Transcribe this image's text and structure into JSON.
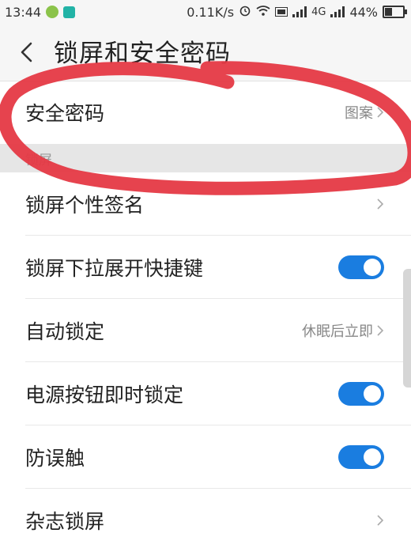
{
  "status_bar": {
    "time": "13:44",
    "net_speed": "0.11K/s",
    "network_type": "4G",
    "battery_percent": "44%"
  },
  "header": {
    "back_icon": "chevron-left-icon",
    "title": "锁屏和安全密码"
  },
  "rows": {
    "security_password": {
      "label": "安全密码",
      "value": "图案"
    },
    "section_lockscreen": "锁屏",
    "lock_signature": {
      "label": "锁屏个性签名"
    },
    "pulldown_shortcut": {
      "label": "锁屏下拉展开快捷键",
      "enabled": true
    },
    "auto_lock": {
      "label": "自动锁定",
      "value": "休眠后立即"
    },
    "power_lock": {
      "label": "电源按钮即时锁定",
      "enabled": true
    },
    "anti_touch": {
      "label": "防误触",
      "enabled": true
    },
    "magazine_lock": {
      "label": "杂志锁屏"
    }
  },
  "colors": {
    "toggle_on": "#1a7de0",
    "annotation_red": "#e53945",
    "section_bg": "#e6e6e6"
  }
}
